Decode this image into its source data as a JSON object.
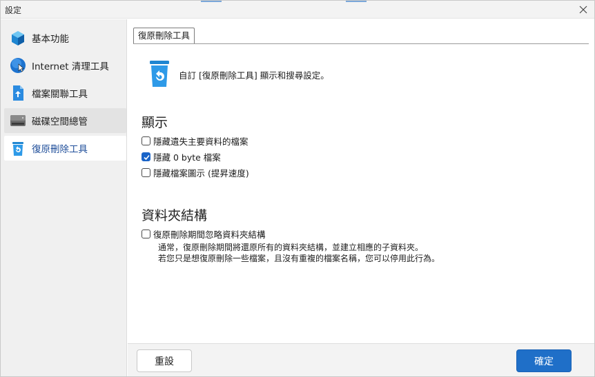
{
  "window": {
    "title": "設定"
  },
  "sidebar": {
    "items": [
      {
        "label": "基本功能",
        "icon": "cube-icon",
        "state": "normal"
      },
      {
        "label": "Internet 清理工具",
        "icon": "globe-icon",
        "state": "normal"
      },
      {
        "label": "檔案關聯工具",
        "icon": "file-association-icon",
        "state": "normal"
      },
      {
        "label": "磁碟空間總管",
        "icon": "disk-icon",
        "state": "hover"
      },
      {
        "label": "復原刪除工具",
        "icon": "recycle-bin-icon",
        "state": "active"
      }
    ]
  },
  "main": {
    "tab_label": "復原刪除工具",
    "description": "自訂 [復原刪除工具] 顯示和搜尋設定。",
    "display_section": {
      "title": "顯示",
      "options": [
        {
          "label": "隱藏遺失主要資料的檔案",
          "checked": false
        },
        {
          "label": "隱藏 0 byte 檔案",
          "checked": true
        },
        {
          "label": "隱藏檔案圖示 (提昇速度)",
          "checked": false
        }
      ]
    },
    "folder_section": {
      "title": "資料夾結構",
      "option": {
        "label": "復原刪除期間忽略資料夾結構",
        "checked": false
      },
      "note_line1": "通常，復原刪除期間將還原所有的資料夾結構，並建立相應的子資料夾。",
      "note_line2": "若您只是想復原刪除一些檔案，且沒有重複的檔案名稱，您可以停用此行為。"
    }
  },
  "footer": {
    "reset_label": "重設",
    "ok_label": "確定"
  },
  "colors": {
    "accent": "#1f6fc8",
    "checkbox_checked": "#1a64c8",
    "active_nav_text": "#1f4e9a"
  }
}
